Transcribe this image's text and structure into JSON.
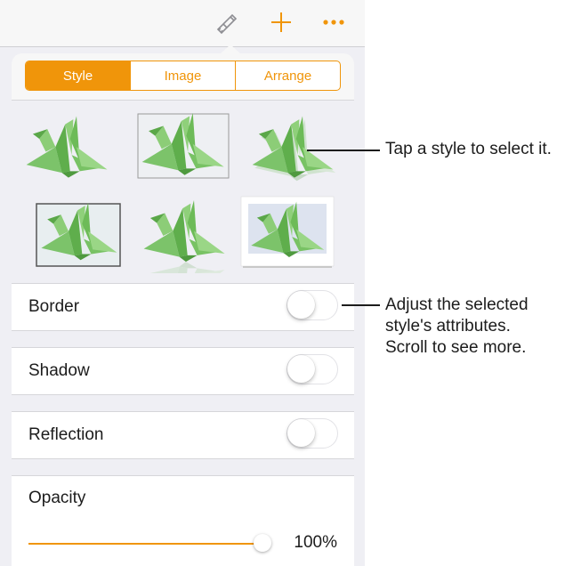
{
  "toolbar": {
    "icons": [
      "format-brush-icon",
      "add-icon",
      "more-icon"
    ],
    "accent": "#f0950a"
  },
  "tabs": [
    {
      "label": "Style",
      "active": true
    },
    {
      "label": "Image",
      "active": false
    },
    {
      "label": "Arrange",
      "active": false
    }
  ],
  "styles_grid": {
    "items": [
      "plain",
      "thin-border",
      "shadow",
      "dark-border",
      "reflection",
      "white-frame"
    ],
    "selected_index": 5
  },
  "attributes": [
    {
      "label": "Border",
      "on": false
    },
    {
      "label": "Shadow",
      "on": false
    },
    {
      "label": "Reflection",
      "on": false
    }
  ],
  "opacity": {
    "label": "Opacity",
    "value_text": "100%",
    "value": 1.0
  },
  "callouts": {
    "styles": "Tap a style to select it.",
    "attributes_lines": [
      "Adjust the selected",
      "style's attributes.",
      "Scroll to see more."
    ]
  }
}
